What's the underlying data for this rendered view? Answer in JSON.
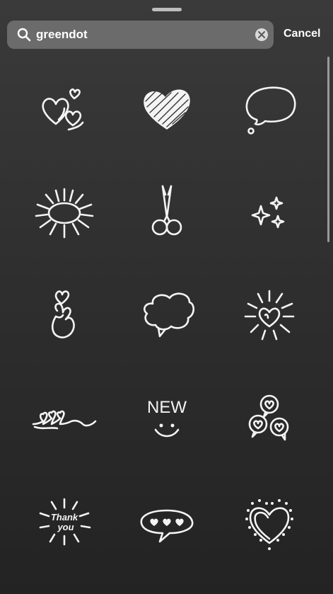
{
  "search": {
    "value": "greendot",
    "cancel_label": "Cancel"
  },
  "stickers": [
    {
      "name": "hearts-doodle"
    },
    {
      "name": "scribbled-heart"
    },
    {
      "name": "thought-bubble"
    },
    {
      "name": "burst-oval"
    },
    {
      "name": "scissors"
    },
    {
      "name": "sparkles"
    },
    {
      "name": "finger-heart-hand"
    },
    {
      "name": "cloud-speech-bubble"
    },
    {
      "name": "shining-heart"
    },
    {
      "name": "heart-loops"
    },
    {
      "name": "new-smiley",
      "text": "NEW"
    },
    {
      "name": "heart-bubbles"
    },
    {
      "name": "thank-you-burst",
      "line1": "Thank",
      "line2": "you"
    },
    {
      "name": "hearts-speech-bubble"
    },
    {
      "name": "dotted-heart"
    }
  ],
  "colors": {
    "background": "#2f2f2f",
    "search_field": "#6b6b6b",
    "ink": "#f4f4f4"
  }
}
